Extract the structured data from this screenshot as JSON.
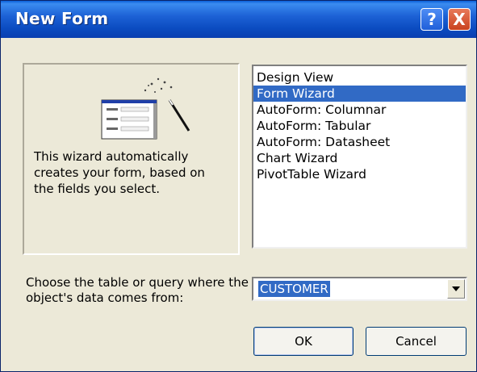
{
  "window": {
    "title": "New Form"
  },
  "title_buttons": {
    "help": "?",
    "close": "X"
  },
  "preview": {
    "description": "This wizard automatically creates your form, based on the fields you select."
  },
  "views": [
    {
      "label": "Design View",
      "selected": false
    },
    {
      "label": "Form Wizard",
      "selected": true
    },
    {
      "label": "AutoForm:  Columnar",
      "selected": false
    },
    {
      "label": "AutoForm:  Tabular",
      "selected": false
    },
    {
      "label": "AutoForm:  Datasheet",
      "selected": false
    },
    {
      "label": "Chart Wizard",
      "selected": false
    },
    {
      "label": "PivotTable Wizard",
      "selected": false
    }
  ],
  "source": {
    "label": "Choose the table or query where the object's data comes from:",
    "value": "CUSTOMER"
  },
  "buttons": {
    "ok": "OK",
    "cancel": "Cancel"
  },
  "colors": {
    "titlebar": "#0b4bc0",
    "selection": "#316ac5",
    "dialog_bg": "#ece9d8"
  }
}
